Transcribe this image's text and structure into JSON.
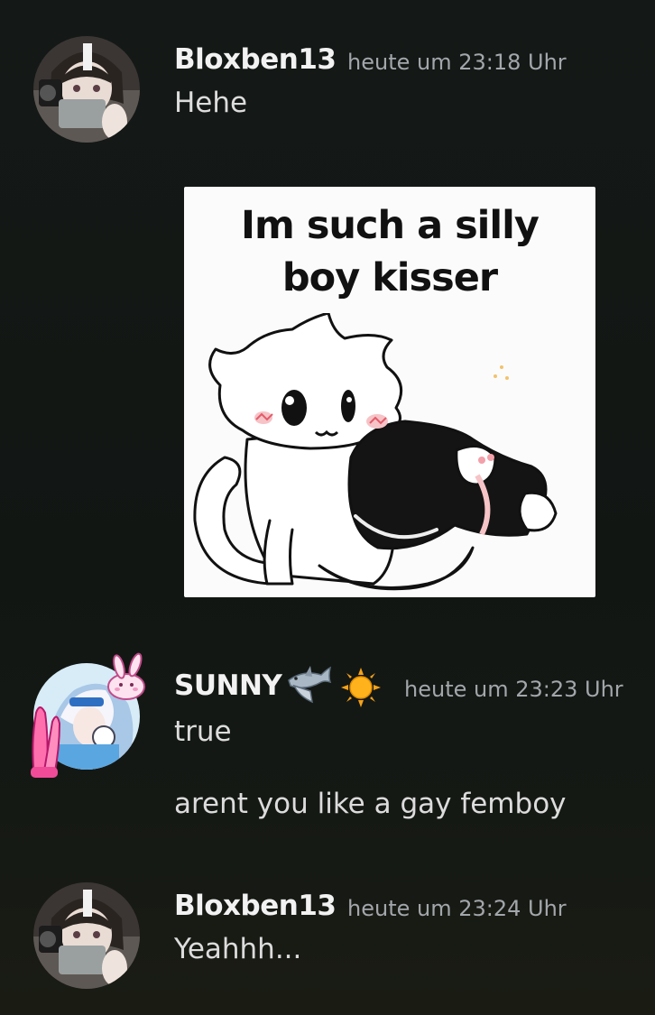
{
  "messages": [
    {
      "author": "Bloxben13",
      "timestamp": "heute um 23:18 Uhr",
      "lines": [
        "Hehe"
      ],
      "attachment": {
        "type": "image",
        "caption_line1": "Im such a silly",
        "caption_line2": "boy kisser"
      }
    },
    {
      "author": "SUNNY",
      "author_badges": [
        "shark-emoji",
        "sun-emoji"
      ],
      "timestamp": "heute um 23:23 Uhr",
      "lines": [
        "true",
        "arent you like a gay femboy"
      ]
    },
    {
      "author": "Bloxben13",
      "timestamp": "heute um 23:24 Uhr",
      "lines": [
        "Yeahhh..."
      ]
    }
  ]
}
